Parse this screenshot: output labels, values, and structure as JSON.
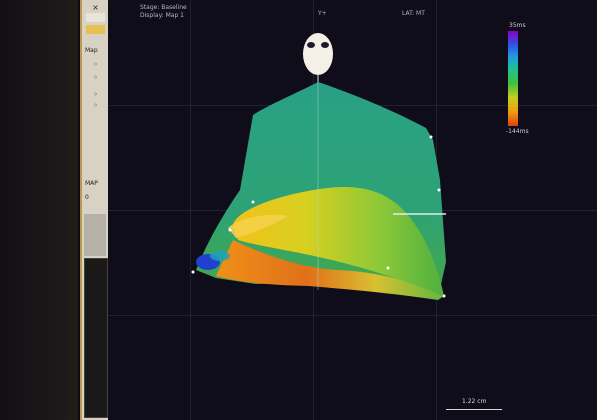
{
  "toolbar": {
    "close_glyph": "×",
    "map_label": "Map",
    "mid_label": "MAP",
    "mid_value": "0"
  },
  "header": {
    "stage": "Stage: Baseline",
    "display": "Display: Map 1",
    "view_label": "Y+",
    "map_type": "LAT: MT"
  },
  "colorbar": {
    "max_label": "35ms",
    "min_label": "-144ms",
    "colors": [
      "#8a00c8",
      "#3050e0",
      "#20a0e0",
      "#20c090",
      "#40c040",
      "#c0d020",
      "#f0a010",
      "#e04010"
    ]
  },
  "scale": {
    "label": "1.22 cm"
  },
  "icons": {
    "orientation": "head-orientation-icon"
  }
}
